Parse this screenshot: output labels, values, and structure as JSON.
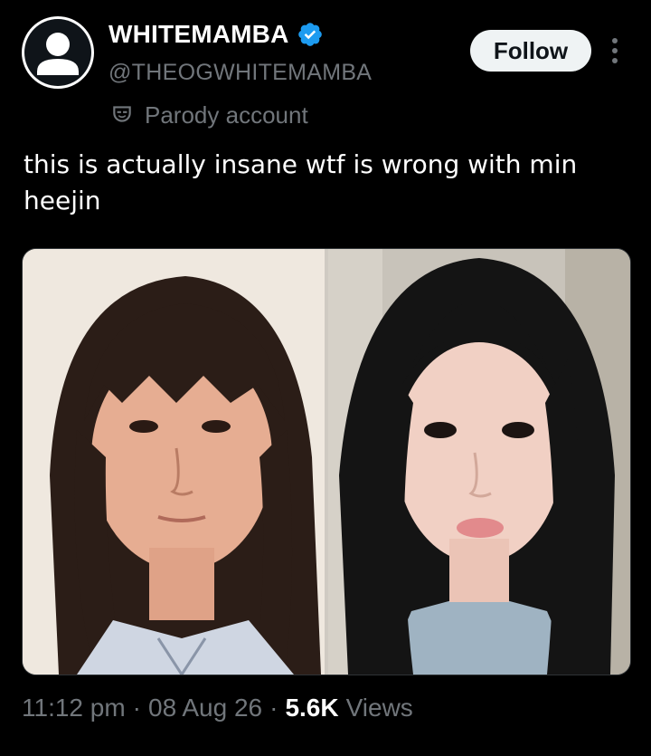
{
  "author": {
    "display_name": "WHITEMAMBA",
    "handle": "@THEOGWHITEMAMBA",
    "verified": true,
    "avatar_icon": "default-profile-icon",
    "parody_label": "Parody account",
    "parody_icon": "mask-icon"
  },
  "actions": {
    "follow_label": "Follow",
    "more_icon": "more-vertical-icon"
  },
  "tweet": {
    "text": "this is actually insane wtf is wrong with min heejin"
  },
  "media": {
    "description_icon": "photo-image"
  },
  "meta": {
    "time": "11:12 pm",
    "date": "08 Aug 26",
    "separator": "·",
    "views_count": "5.6K",
    "views_label": "Views"
  },
  "colors": {
    "background": "#000000",
    "text_primary": "#ffffff",
    "text_secondary": "#71767b",
    "verified": "#1d9bf0",
    "button_bg": "#eff3f4"
  }
}
